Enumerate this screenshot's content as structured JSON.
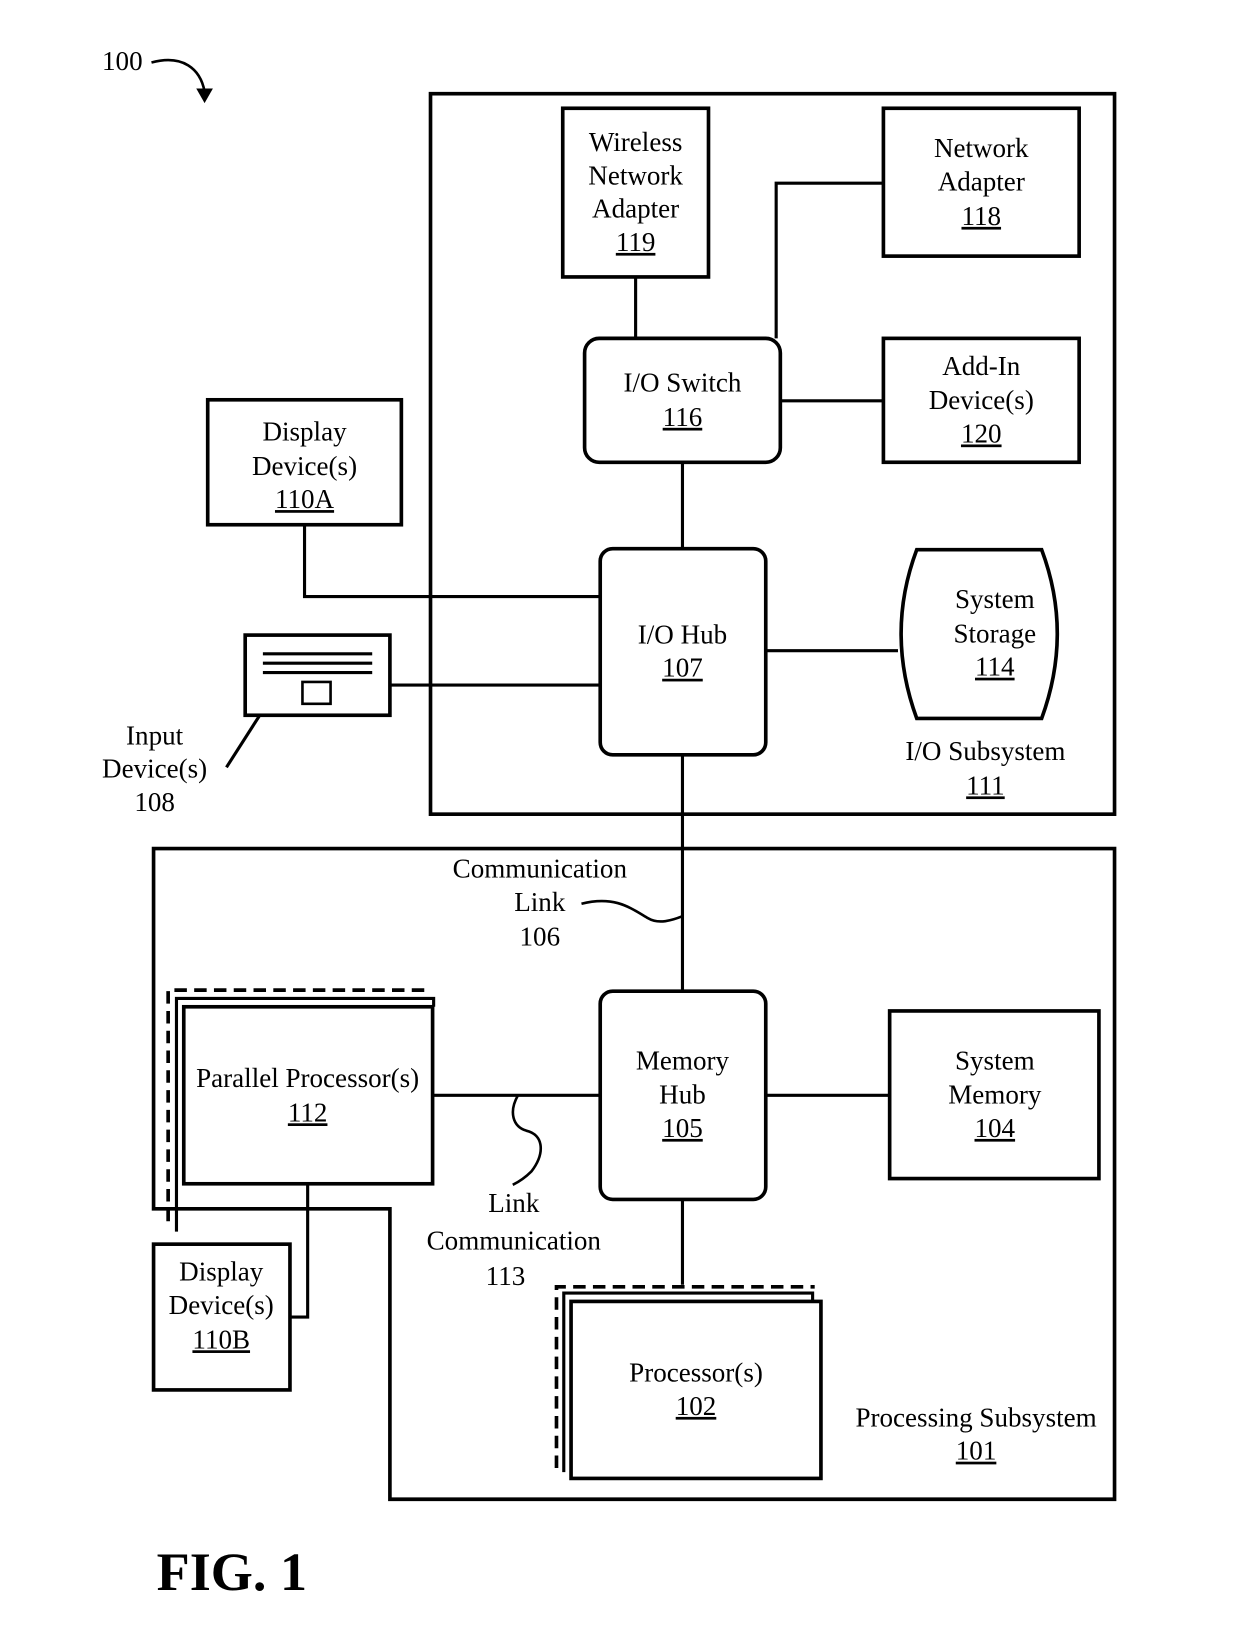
{
  "figure": {
    "ref": "100",
    "caption": "FIG. 1"
  },
  "io_subsystem": {
    "title": "I/O Subsystem",
    "ref": "111",
    "wireless_adapter": {
      "lines": [
        "Wireless",
        "Network",
        "Adapter"
      ],
      "ref": "119"
    },
    "network_adapter": {
      "lines": [
        "Network",
        "Adapter"
      ],
      "ref": "118"
    },
    "io_switch": {
      "lines": [
        "I/O Switch"
      ],
      "ref": "116"
    },
    "addin_devices": {
      "lines": [
        "Add-In",
        "Device(s)"
      ],
      "ref": "120"
    },
    "io_hub": {
      "lines": [
        "I/O Hub"
      ],
      "ref": "107"
    },
    "system_storage": {
      "lines": [
        "System",
        "Storage"
      ],
      "ref": "114"
    }
  },
  "external": {
    "display_a": {
      "lines": [
        "Display",
        "Device(s)"
      ],
      "ref": "110A"
    },
    "input_devices": {
      "lines": [
        "Input",
        "Device(s)"
      ],
      "ref": "108"
    },
    "display_b": {
      "lines": [
        "Display",
        "Device(s)"
      ],
      "ref": "110B"
    }
  },
  "processing_subsystem": {
    "title": "Processing Subsystem",
    "ref": "101",
    "comm_link": {
      "lines": [
        "Communication",
        "Link"
      ],
      "ref": "106"
    },
    "parallel_processors": {
      "lines": [
        "Parallel Processor(s)"
      ],
      "ref": "112"
    },
    "link_comm": {
      "lines": [
        "Link",
        "Communication"
      ],
      "ref": "113"
    },
    "memory_hub": {
      "lines": [
        "Memory",
        "Hub"
      ],
      "ref": "105"
    },
    "system_memory": {
      "lines": [
        "System",
        "Memory"
      ],
      "ref": "104"
    },
    "processors": {
      "lines": [
        "Processor(s)"
      ],
      "ref": "102"
    }
  }
}
